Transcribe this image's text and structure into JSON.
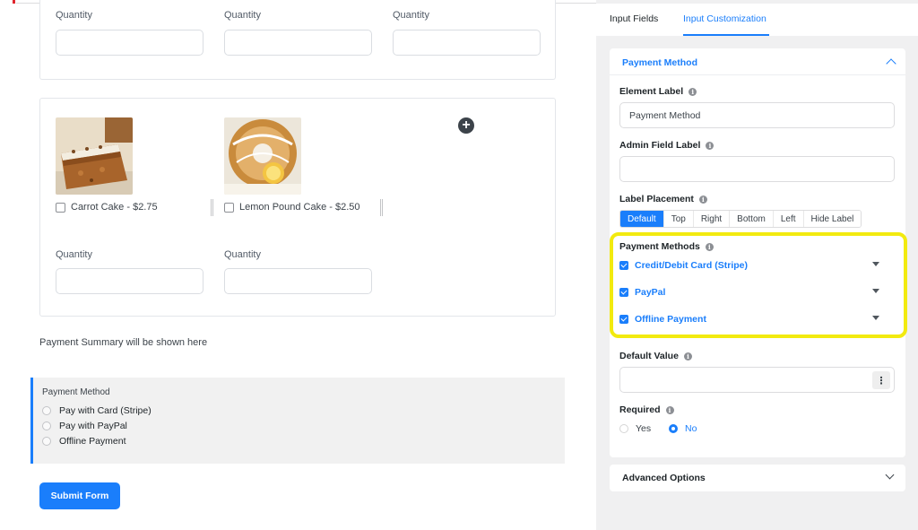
{
  "form": {
    "quantity_label": "Quantity",
    "products": [
      {
        "name": "Carrot Cake - $2.75",
        "image": "carrot-cake-image"
      },
      {
        "name": "Lemon Pound Cake - $2.50",
        "image": "lemon-pound-cake-image"
      }
    ],
    "add_icon": "plus-circle-icon",
    "payment_summary": "Payment Summary will be shown here",
    "payment_block": {
      "title": "Payment Method",
      "options": [
        "Pay with Card (Stripe)",
        "Pay with PayPal",
        "Offline Payment"
      ]
    },
    "submit_label": "Submit Form"
  },
  "panel": {
    "tabs": [
      "Input Fields",
      "Input Customization"
    ],
    "active_tab": "Input Customization",
    "section_title": "Payment Method",
    "element_label": {
      "label": "Element Label",
      "value": "Payment Method"
    },
    "admin_field_label": {
      "label": "Admin Field Label",
      "value": ""
    },
    "label_placement": {
      "label": "Label Placement",
      "options": [
        "Default",
        "Top",
        "Right",
        "Bottom",
        "Left",
        "Hide Label"
      ],
      "selected": "Default"
    },
    "payment_methods": {
      "label": "Payment Methods",
      "items": [
        "Credit/Debit Card (Stripe)",
        "PayPal",
        "Offline Payment"
      ]
    },
    "default_value": {
      "label": "Default Value",
      "value": ""
    },
    "required": {
      "label": "Required",
      "options": [
        "Yes",
        "No"
      ],
      "selected": "No"
    },
    "advanced_options": "Advanced Options"
  },
  "colors": {
    "accent": "#1a7efb",
    "highlight": "#f2ea0f"
  }
}
